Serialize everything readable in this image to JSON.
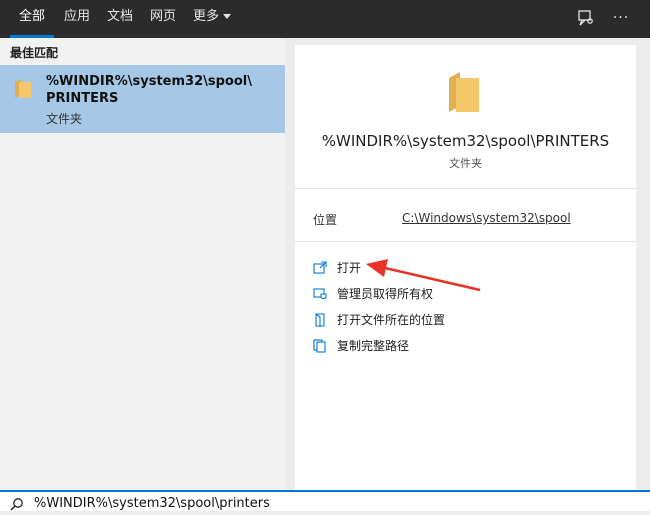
{
  "tabs": [
    "全部",
    "应用",
    "文档",
    "网页",
    "更多"
  ],
  "left": {
    "section_label": "最佳匹配",
    "result": {
      "title_line1": "%WINDIR%\\system32\\spool\\",
      "title_line2": "PRINTERS",
      "type": "文件夹"
    }
  },
  "detail": {
    "title": "%WINDIR%\\system32\\spool\\PRINTERS",
    "type": "文件夹",
    "location_label": "位置",
    "location_value": "C:\\Windows\\system32\\spool",
    "actions": [
      "打开",
      "管理员取得所有权",
      "打开文件所在的位置",
      "复制完整路径"
    ]
  },
  "search": {
    "query": "%WINDIR%\\system32\\spool\\printers"
  },
  "colors": {
    "accent": "#0078d4",
    "selected": "#a6c8e6",
    "folder": "#f4c86a",
    "arrow": "#e8322a"
  },
  "icons": [
    "feedback-icon",
    "more-icon",
    "folder-icon",
    "open-icon",
    "shield-icon",
    "file-location-icon",
    "copy-icon",
    "search-icon"
  ]
}
